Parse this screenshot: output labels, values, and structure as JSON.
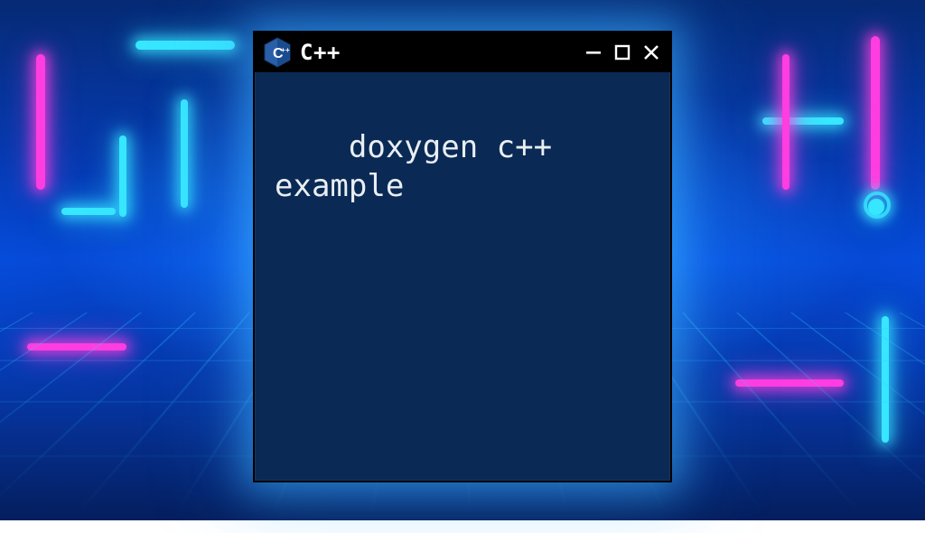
{
  "window": {
    "title": "C++",
    "icon": "cpp-logo-icon",
    "controls": {
      "minimize_icon": "minimize-icon",
      "maximize_icon": "maximize-icon",
      "close_icon": "close-icon"
    }
  },
  "terminal": {
    "content": "doxygen c++ example"
  },
  "colors": {
    "window_bg": "#0a2a55",
    "titlebar_bg": "#000000",
    "text": "#e9eef2",
    "neon_pink": "#ff3de0",
    "neon_cyan": "#37e6ff"
  }
}
